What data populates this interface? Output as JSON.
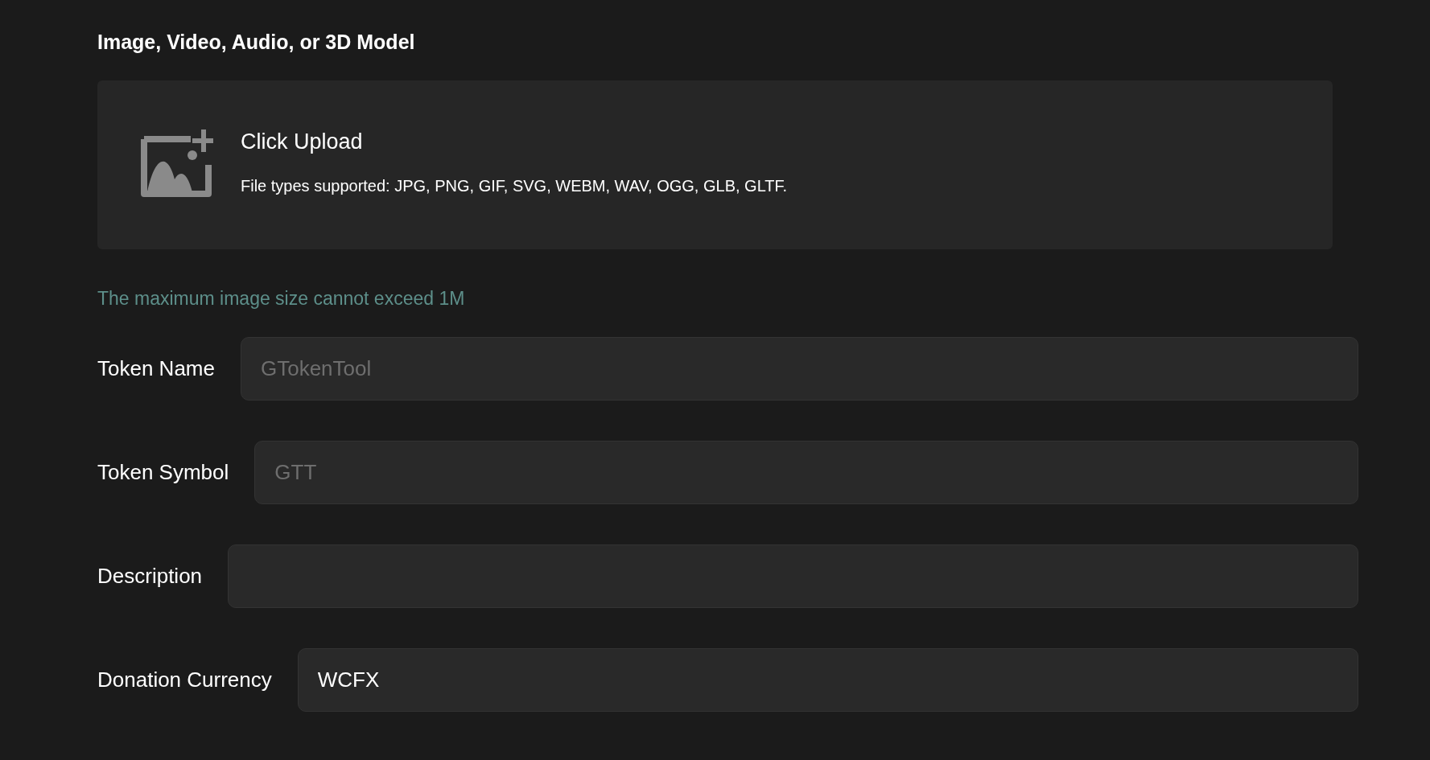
{
  "section_title": "Image, Video, Audio, or 3D Model",
  "upload": {
    "title": "Click Upload",
    "subtitle": "File types supported: JPG, PNG, GIF, SVG, WEBM, WAV, OGG, GLB, GLTF."
  },
  "size_note": "The maximum image size cannot exceed 1M",
  "fields": [
    {
      "label": "Token Name",
      "placeholder": "GTokenTool"
    },
    {
      "label": "Token Symbol",
      "placeholder": "GTT"
    },
    {
      "label": "Description"
    },
    {
      "label": "Donation Currency",
      "value": "WCFX"
    }
  ]
}
